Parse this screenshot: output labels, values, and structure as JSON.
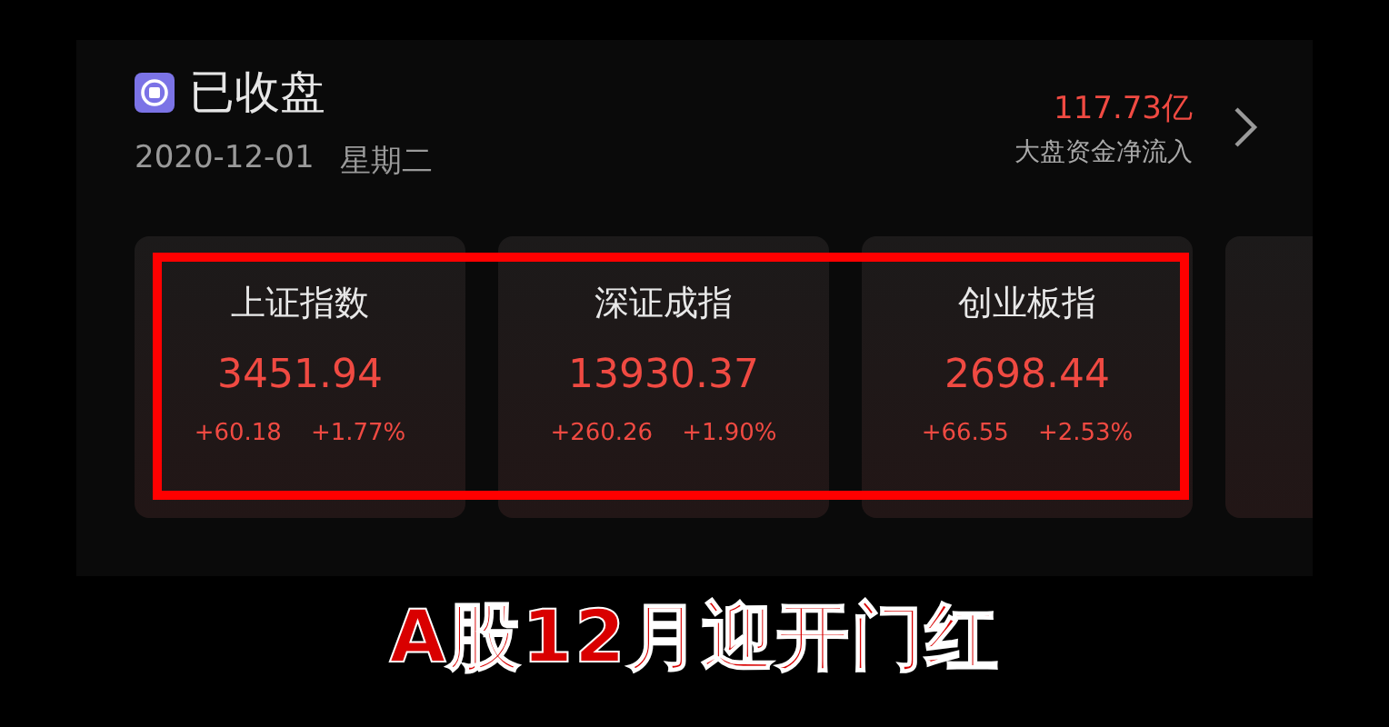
{
  "header": {
    "status": "已收盘",
    "date": "2020-12-01",
    "weekday": "星期二",
    "net_inflow": "117.73亿",
    "net_inflow_label": "大盘资金净流入"
  },
  "indices": [
    {
      "name": "上证指数",
      "value": "3451.94",
      "change": "+60.18",
      "percent": "+1.77%"
    },
    {
      "name": "深证成指",
      "value": "13930.37",
      "change": "+260.26",
      "percent": "+1.90%"
    },
    {
      "name": "创业板指",
      "value": "2698.44",
      "change": "+66.55",
      "percent": "+2.53%"
    }
  ],
  "caption": "A股12月迎开门红"
}
